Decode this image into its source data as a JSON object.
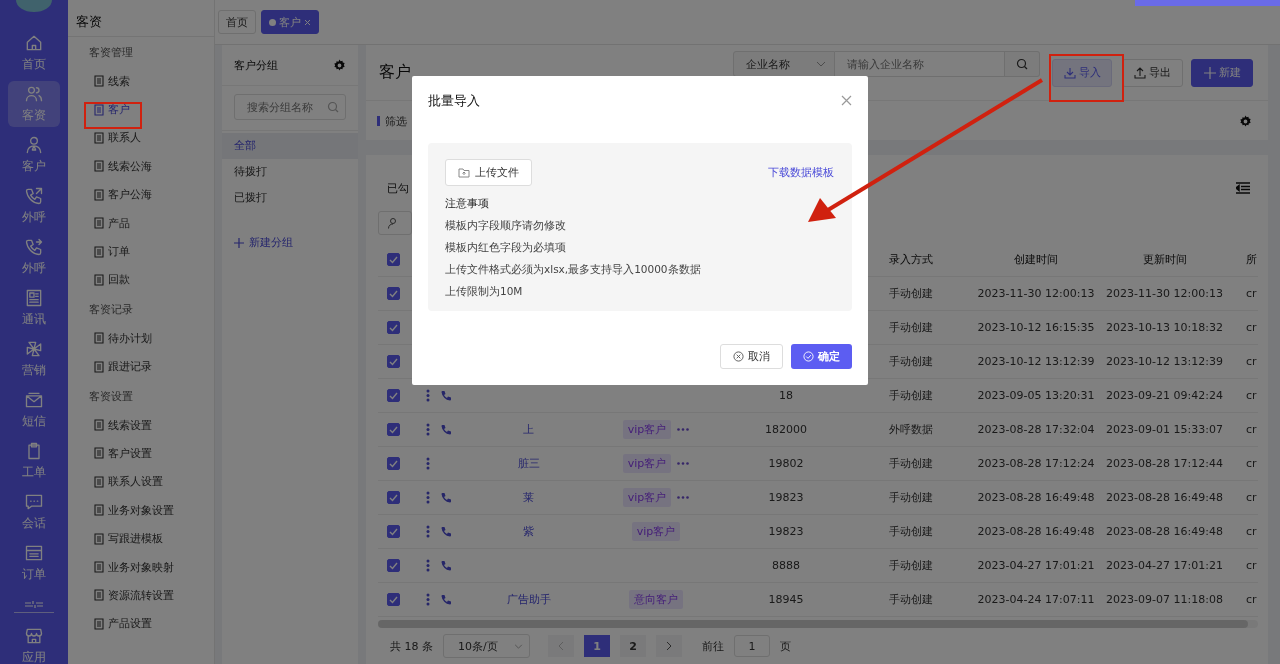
{
  "rail": {
    "items": [
      {
        "label": "首页",
        "selected": false
      },
      {
        "label": "客资",
        "selected": true
      },
      {
        "label": "客户",
        "selected": false
      },
      {
        "label": "外呼",
        "selected": false
      },
      {
        "label": "外呼",
        "selected": false
      },
      {
        "label": "通讯",
        "selected": false
      },
      {
        "label": "营销",
        "selected": false
      },
      {
        "label": "短信",
        "selected": false
      },
      {
        "label": "工单",
        "selected": false
      },
      {
        "label": "会话",
        "selected": false
      },
      {
        "label": "订单",
        "selected": false
      }
    ],
    "bottom_item": {
      "label": "应用",
      "selected": false
    }
  },
  "sidebar": {
    "title": "客资",
    "sections": [
      {
        "title": "客资管理",
        "items": [
          {
            "label": "线索",
            "selected": false
          },
          {
            "label": "客户",
            "selected": true
          },
          {
            "label": "联系人",
            "selected": false
          },
          {
            "label": "线索公海",
            "selected": false
          },
          {
            "label": "客户公海",
            "selected": false
          },
          {
            "label": "产品",
            "selected": false
          },
          {
            "label": "订单",
            "selected": false
          },
          {
            "label": "回款",
            "selected": false
          }
        ]
      },
      {
        "title": "客资记录",
        "items": [
          {
            "label": "待办计划",
            "selected": false
          },
          {
            "label": "跟进记录",
            "selected": false
          }
        ]
      },
      {
        "title": "客资设置",
        "items": [
          {
            "label": "线索设置",
            "selected": false
          },
          {
            "label": "客户设置",
            "selected": false
          },
          {
            "label": "联系人设置",
            "selected": false
          },
          {
            "label": "业务对象设置",
            "selected": false
          },
          {
            "label": "写跟进模板",
            "selected": false
          },
          {
            "label": "业务对象映射",
            "selected": false
          },
          {
            "label": "资源流转设置",
            "selected": false
          },
          {
            "label": "产品设置",
            "selected": false
          }
        ]
      }
    ]
  },
  "tabs": [
    {
      "label": "首页",
      "selected": false,
      "closable": false
    },
    {
      "label": "客户",
      "selected": true,
      "closable": true
    }
  ],
  "groups": {
    "title": "客户分组",
    "search_placeholder": "搜索分组名称",
    "items": [
      {
        "label": "全部",
        "selected": true
      },
      {
        "label": "待拨打",
        "selected": false
      },
      {
        "label": "已拨打",
        "selected": false
      }
    ],
    "new_group": "新建分组"
  },
  "main": {
    "title": "客户",
    "search_select": "企业名称",
    "search_placeholder": "请输入企业名称",
    "buttons": [
      {
        "label": "导入",
        "kind": "import"
      },
      {
        "label": "导出",
        "kind": "export"
      },
      {
        "label": "新建",
        "kind": "primary"
      }
    ],
    "filter_label": "筛选",
    "selected_label": "已勾"
  },
  "table": {
    "header_checked": true,
    "columns": [
      "录入方式",
      "创建时间",
      "更新时间",
      "所"
    ],
    "rows": [
      {
        "checked": true,
        "menu": false,
        "call": false,
        "cells": [
          "手动创建",
          "2023-11-30 12:00:13",
          "2023-11-30 12:00:13",
          "cr"
        ]
      },
      {
        "checked": true,
        "menu": false,
        "call": false,
        "cells": [
          "手动创建",
          "2023-10-12 16:15:35",
          "2023-10-13 10:18:32",
          "cr"
        ]
      },
      {
        "checked": true,
        "menu": false,
        "call": false,
        "cells": [
          "手动创建",
          "2023-10-12 13:12:39",
          "2023-10-12 13:12:39",
          "cr"
        ]
      },
      {
        "checked": true,
        "menu": true,
        "call": true,
        "phone": "18",
        "cells": [
          "手动创建",
          "2023-09-05 13:20:31",
          "2023-09-21 09:42:24",
          "cr"
        ]
      },
      {
        "checked": true,
        "menu": true,
        "call": true,
        "name": "上",
        "tag": "vip客户",
        "tag_more": true,
        "phone": "182000",
        "cells": [
          "外呼数据",
          "2023-08-28 17:32:04",
          "2023-09-01 15:33:07",
          "cr"
        ]
      },
      {
        "checked": true,
        "menu": true,
        "call": false,
        "name": "脏三",
        "tag": "vip客户",
        "tag_more": true,
        "phone": "19802",
        "cells": [
          "手动创建",
          "2023-08-28 17:12:24",
          "2023-08-28 17:12:44",
          "cr"
        ]
      },
      {
        "checked": true,
        "menu": true,
        "call": true,
        "name": "莱",
        "tag": "vip客户",
        "tag_more": true,
        "phone": "19823",
        "cells": [
          "手动创建",
          "2023-08-28 16:49:48",
          "2023-08-28 16:49:48",
          "cr"
        ]
      },
      {
        "checked": true,
        "menu": true,
        "call": true,
        "name": "紫",
        "tag": "vip客户",
        "tag_more": false,
        "phone": "19823",
        "cells": [
          "手动创建",
          "2023-08-28 16:49:48",
          "2023-08-28 16:49:48",
          "cr"
        ]
      },
      {
        "checked": true,
        "menu": true,
        "call": true,
        "phone": "8888",
        "cells": [
          "手动创建",
          "2023-04-27 17:01:21",
          "2023-04-27 17:01:21",
          "cr"
        ]
      },
      {
        "checked": true,
        "menu": true,
        "call": true,
        "name": "广告助手",
        "tag": "意向客户",
        "tag_more": false,
        "phone": "18945",
        "cells": [
          "手动创建",
          "2023-04-24 17:07:11",
          "2023-09-07 11:18:08",
          "cr"
        ]
      }
    ]
  },
  "pagination": {
    "total": "共 18 条",
    "page_size": "10条/页",
    "pages": [
      {
        "label": "1",
        "selected": true
      },
      {
        "label": "2",
        "selected": false
      }
    ],
    "goto_label": "前往",
    "goto_value": "1",
    "goto_suffix": "页"
  },
  "modal": {
    "title": "批量导入",
    "upload_button": "上传文件",
    "template_link": "下载数据模板",
    "notes_title": "注意事项",
    "notes": [
      "模板内字段顺序请勿修改",
      "模板内红色字段为必填项",
      "上传文件格式必须为xlsx,最多支持导入10000条数据",
      "上传限制为10M"
    ],
    "cancel": "取消",
    "confirm": "确定"
  }
}
